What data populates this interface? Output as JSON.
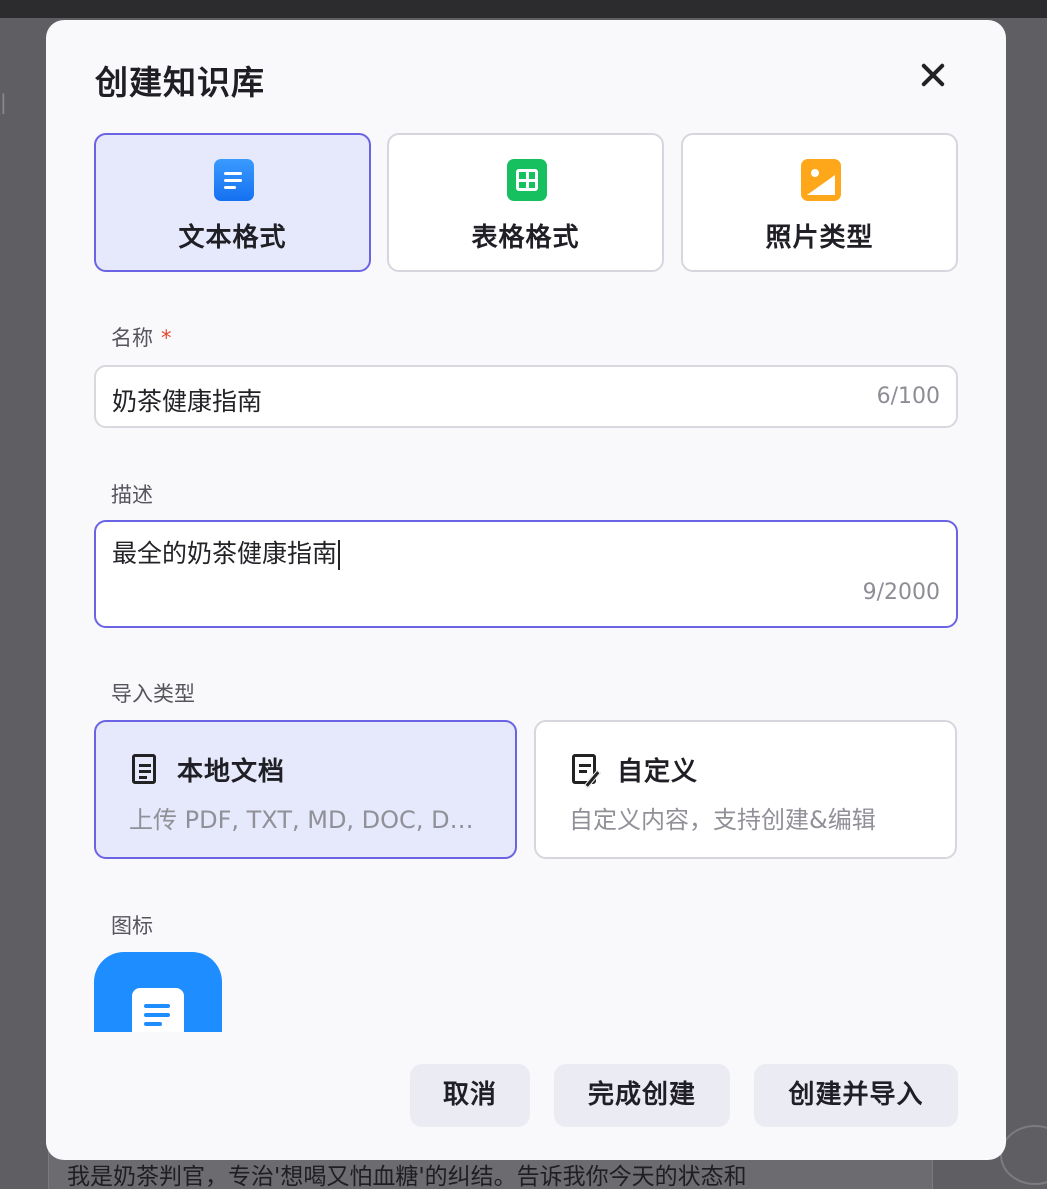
{
  "background": {
    "bottom_text": "我是奶茶判官，专治'想喝又怕血糖'的纠结。告诉我你今天的状态和"
  },
  "dialog": {
    "title": "创建知识库",
    "close_icon": "close-icon"
  },
  "format_options": [
    {
      "label": "文本格式",
      "icon": "document-icon",
      "color": "#1f7bff",
      "selected": true
    },
    {
      "label": "表格格式",
      "icon": "spreadsheet-icon",
      "color": "#16c05f",
      "selected": false
    },
    {
      "label": "照片类型",
      "icon": "image-icon",
      "color": "#ffa71a",
      "selected": false
    }
  ],
  "name_field": {
    "label": "名称",
    "required_mark": "*",
    "value": "奶茶健康指南",
    "counter": "6/100"
  },
  "description_field": {
    "label": "描述",
    "value": "最全的奶茶健康指南",
    "counter": "9/2000"
  },
  "import_type": {
    "label": "导入类型",
    "options": [
      {
        "title": "本地文档",
        "subtitle": "上传 PDF, TXT, MD, DOC, DOCX 格式的本地文件",
        "icon": "file-text-icon",
        "selected": true
      },
      {
        "title": "自定义",
        "subtitle": "自定义内容，支持创建&编辑",
        "icon": "edit-file-icon",
        "selected": false
      }
    ]
  },
  "icon_field": {
    "label": "图标",
    "icon": "document-icon",
    "color": "#1d8dff"
  },
  "footer": {
    "cancel_label": "取消",
    "finish_label": "完成创建",
    "create_import_label": "创建并导入"
  },
  "colors": {
    "accent": "#6a63e4",
    "selected_bg": "#e6e8fb",
    "required": "#e5482f"
  }
}
